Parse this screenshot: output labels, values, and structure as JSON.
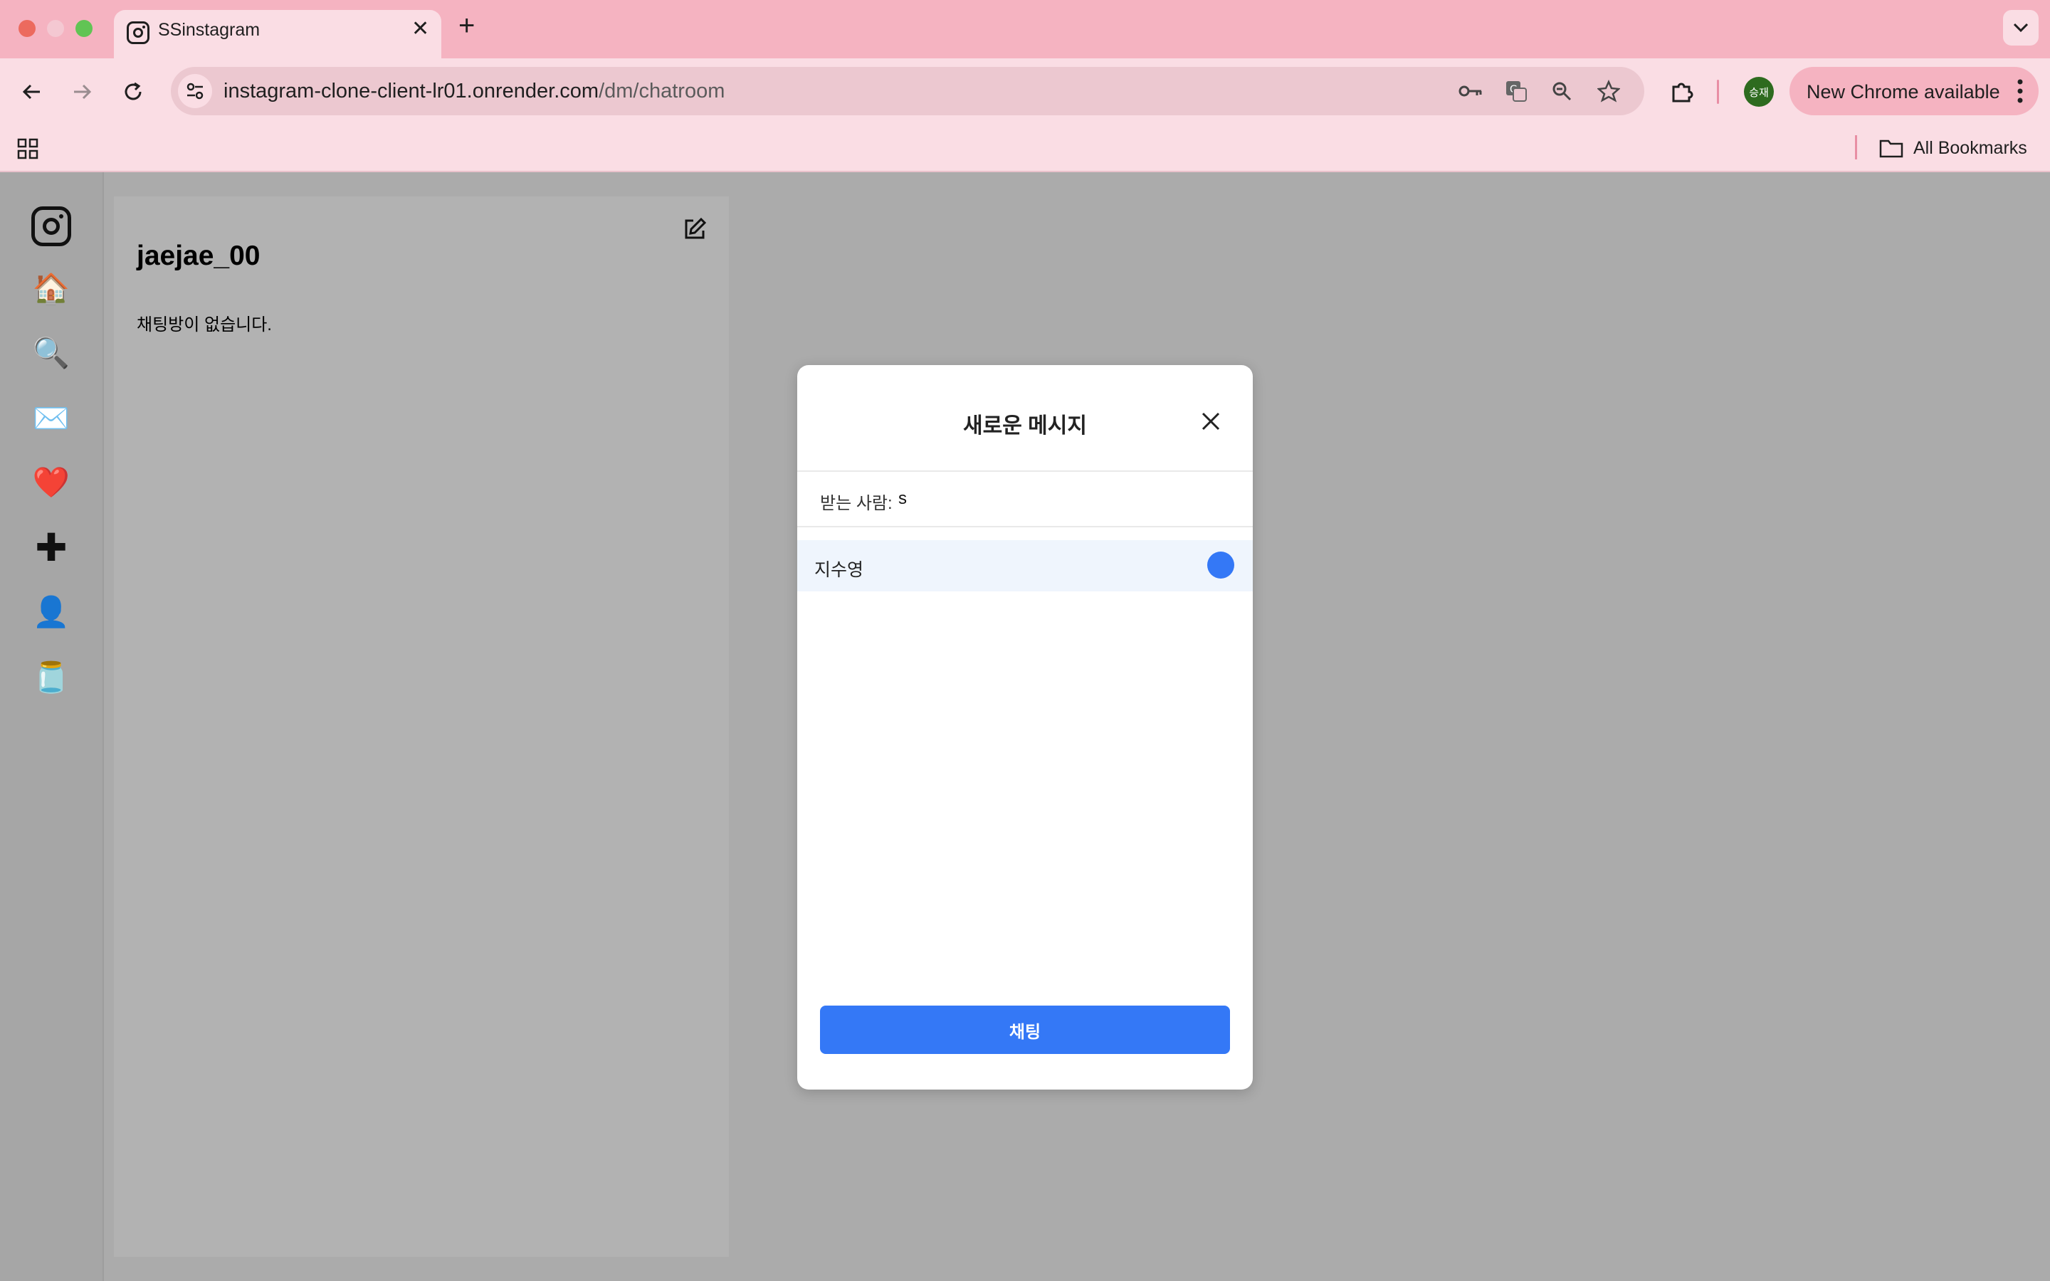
{
  "browser": {
    "tab_title": "SSinstagram",
    "url_host": "instagram-clone-client-lr01.onrender.com",
    "url_path": "/dm/chatroom",
    "profile_initials": "승재",
    "update_label": "New Chrome available",
    "bookmarks_label": "All Bookmarks",
    "colors": {
      "tabbar": "#f5b3c1",
      "toolbar": "#fadde4"
    }
  },
  "sidebar": {
    "items": [
      {
        "name": "home",
        "glyph": "🏠"
      },
      {
        "name": "search",
        "glyph": "🔍"
      },
      {
        "name": "messages",
        "glyph": "✉️"
      },
      {
        "name": "notifications",
        "glyph": "❤️"
      },
      {
        "name": "create",
        "glyph": "✚"
      },
      {
        "name": "profile",
        "glyph": "👤"
      },
      {
        "name": "more",
        "glyph": "🫙"
      }
    ]
  },
  "dm": {
    "username": "jaejae_00",
    "empty_text": "채팅방이 없습니다."
  },
  "modal": {
    "title": "새로운 메시지",
    "recipient_label": "받는 사람:",
    "recipient_value": "s",
    "results": [
      {
        "name": "지수영",
        "selected": true
      }
    ],
    "chat_button": "채팅",
    "accent": "#3478f6"
  }
}
